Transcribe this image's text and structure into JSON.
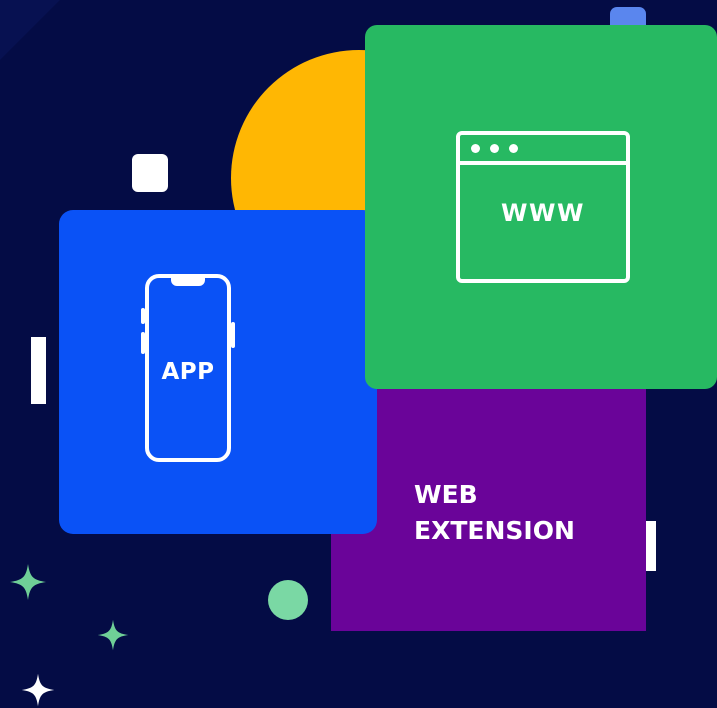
{
  "cards": {
    "app": {
      "label": "APP",
      "icon": "smartphone-icon",
      "color": "#0a52f6"
    },
    "web": {
      "label": "WWW",
      "icon": "browser-window-icon",
      "color": "#27b962"
    },
    "extension": {
      "lines": [
        "WEB",
        "EXTENSION"
      ],
      "color": "#6a0499"
    }
  },
  "decorations": {
    "background": "#040c45",
    "sun": "#ffb703",
    "accent_blue": "#5a86ee",
    "accent_green": "#7ad8a4",
    "sparkles": [
      "sparkle-icon",
      "sparkle-icon",
      "sparkle-icon"
    ]
  }
}
